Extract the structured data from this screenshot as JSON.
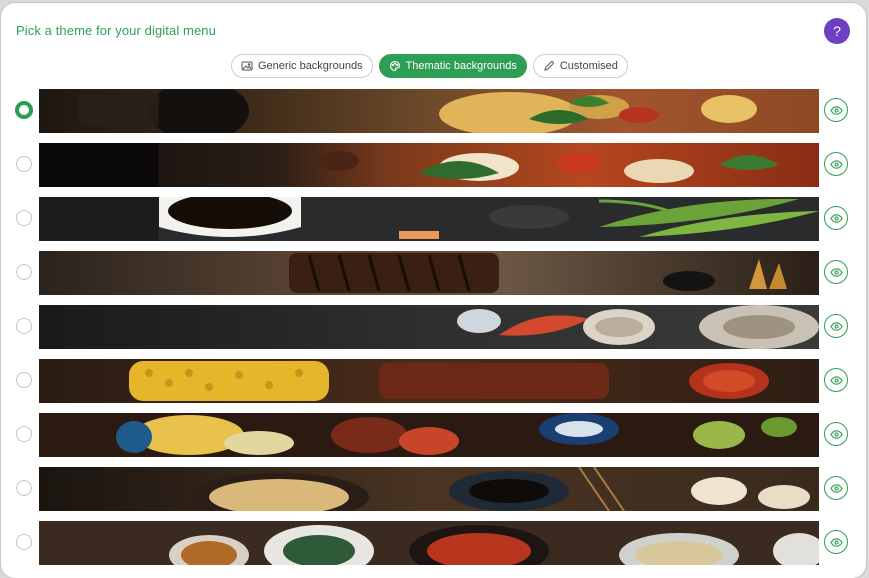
{
  "header": {
    "title": "Pick a theme for your digital menu",
    "help_label": "?"
  },
  "tabs": [
    {
      "label": "Generic backgrounds",
      "icon": "image-icon",
      "active": false
    },
    {
      "label": "Thematic backgrounds",
      "icon": "theme-icon",
      "active": true
    },
    {
      "label": "Customised",
      "icon": "pencil-icon",
      "active": false
    }
  ],
  "colors": {
    "accent": "#2e9e55",
    "help": "#6c3fc5",
    "title": "#2ea15a"
  },
  "themes": [
    {
      "selected": true,
      "icon": "eye-icon",
      "scene": "pasta-dumplings-on-wood"
    },
    {
      "selected": false,
      "icon": "eye-icon",
      "scene": "pizza-with-basil"
    },
    {
      "selected": false,
      "icon": "eye-icon",
      "scene": "soy-sauce-sushi-fern"
    },
    {
      "selected": false,
      "icon": "eye-icon",
      "scene": "grilled-steak-on-wood"
    },
    {
      "selected": false,
      "icon": "eye-icon",
      "scene": "shrimp-and-oysters"
    },
    {
      "selected": false,
      "icon": "eye-icon",
      "scene": "corn-and-ribs-bbq"
    },
    {
      "selected": false,
      "icon": "eye-icon",
      "scene": "tacos-and-salsa"
    },
    {
      "selected": false,
      "icon": "eye-icon",
      "scene": "noodles-and-dumplings"
    },
    {
      "selected": false,
      "icon": "eye-icon",
      "scene": "bowls-of-soup-and-curry"
    }
  ]
}
